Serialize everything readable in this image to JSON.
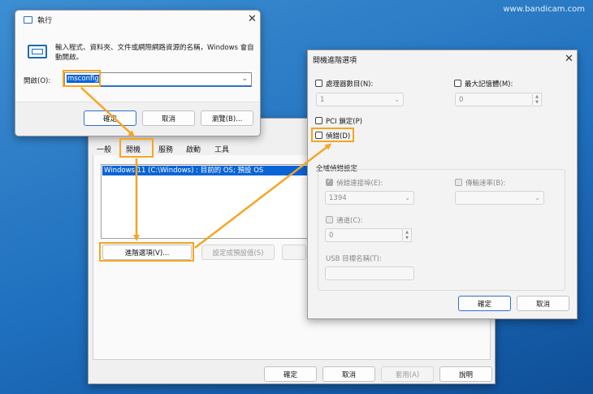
{
  "watermark": "www.bandicam.com",
  "run_dialog": {
    "title": "執行",
    "description": "輸入程式、資料夾、文件或網際網路資源的名稱，Windows 會自動開啟。",
    "open_label": "開啟(O):",
    "open_value": "msconfig",
    "ok": "確定",
    "cancel": "取消",
    "browse": "瀏覽(B)..."
  },
  "msconfig": {
    "tabs": [
      "一般",
      "開機",
      "服務",
      "啟動",
      "工具"
    ],
    "boot_entries": [
      "Windows 11 (C:\\Windows) : 目前的 OS; 預設 OS"
    ],
    "advanced_button": "進階選項(V)...",
    "set_default_button": "設定成預設值(S)",
    "ok": "確定",
    "cancel": "取消",
    "apply": "套用(A)",
    "help": "說明"
  },
  "advanced_dialog": {
    "title": "開機進階選項",
    "num_processors_label": "處理器數目(N):",
    "num_processors_value": "1",
    "max_memory_label": "最大記憶體(M):",
    "max_memory_value": "0",
    "pci_lock_label": "PCI 鎖定(P)",
    "debug_label": "偵錯(D)",
    "global_debug_label": "全域偵錯設定",
    "debug_port_label": "偵錯連接埠(E):",
    "debug_port_value": "1394",
    "baud_rate_label": "傳輸速率(B):",
    "channel_label": "通道(C):",
    "channel_value": "0",
    "usb_target_label": "USB 目標名稱(T):",
    "ok": "確定",
    "cancel": "取消"
  },
  "colors": {
    "highlight": "#f5a623",
    "accent": "#2f6fd0",
    "selection": "#0a64d6"
  }
}
